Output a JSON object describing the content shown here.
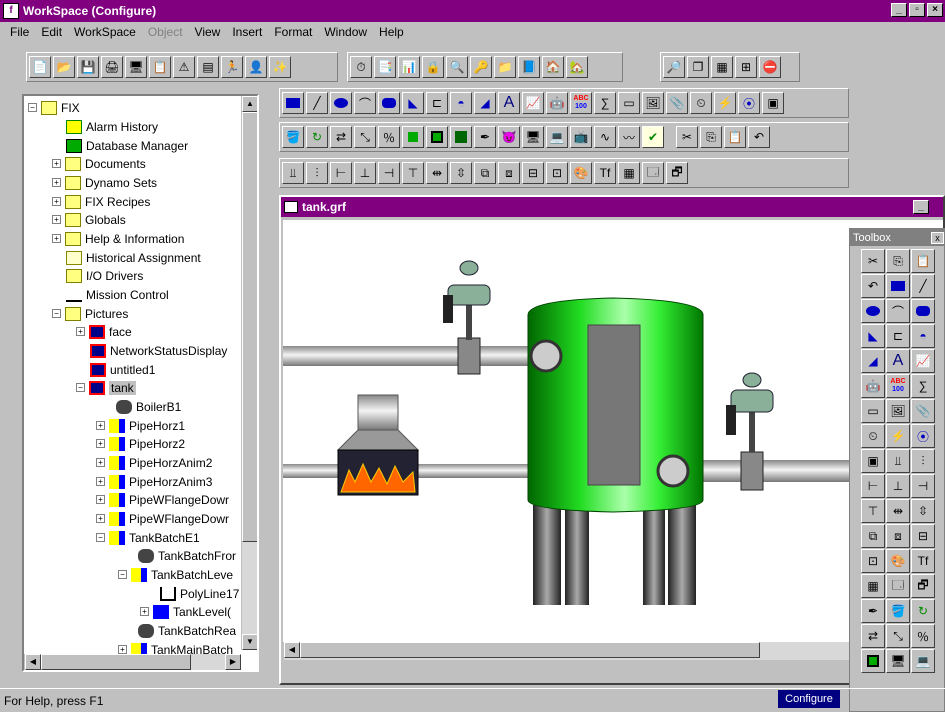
{
  "app": {
    "title": "WorkSpace (Configure)",
    "icon_letter": "f"
  },
  "menu": [
    "File",
    "Edit",
    "WorkSpace",
    "Object",
    "View",
    "Insert",
    "Format",
    "Window",
    "Help"
  ],
  "tree": {
    "root": "FIX",
    "items": [
      "Alarm History",
      "Database Manager",
      "Documents",
      "Dynamo Sets",
      "FIX Recipes",
      "Globals",
      "Help & Information",
      "Historical Assignment",
      "I/O Drivers",
      "Mission Control",
      "Pictures"
    ],
    "pictures": [
      "face",
      "NetworkStatusDisplay",
      "untitled1",
      "tank"
    ],
    "tank_children": [
      "BoilerB1",
      "PipeHorz1",
      "PipeHorz2",
      "PipeHorzAnim2",
      "PipeHorzAnim3",
      "PipeWFlangeDowr",
      "PipeWFlangeDowr",
      "TankBatchE1"
    ],
    "tankbatch_children": [
      "TankBatchFror",
      "TankBatchLeve"
    ],
    "tankbatchleve_children": [
      "PolyLine17",
      "TankLevel("
    ],
    "tail": [
      "TankBatchRea",
      "TankMainBatch"
    ]
  },
  "picture": {
    "title": "tank.grf"
  },
  "toolbox": {
    "title": "Toolbox",
    "close": "x"
  },
  "status": {
    "text": "For Help, press F1",
    "mode": "Configure"
  },
  "icons": {
    "abc_top": "ABC",
    "abc_bottom": "100",
    "text_a": "A",
    "vars": "Tf",
    "cut": "✂"
  }
}
